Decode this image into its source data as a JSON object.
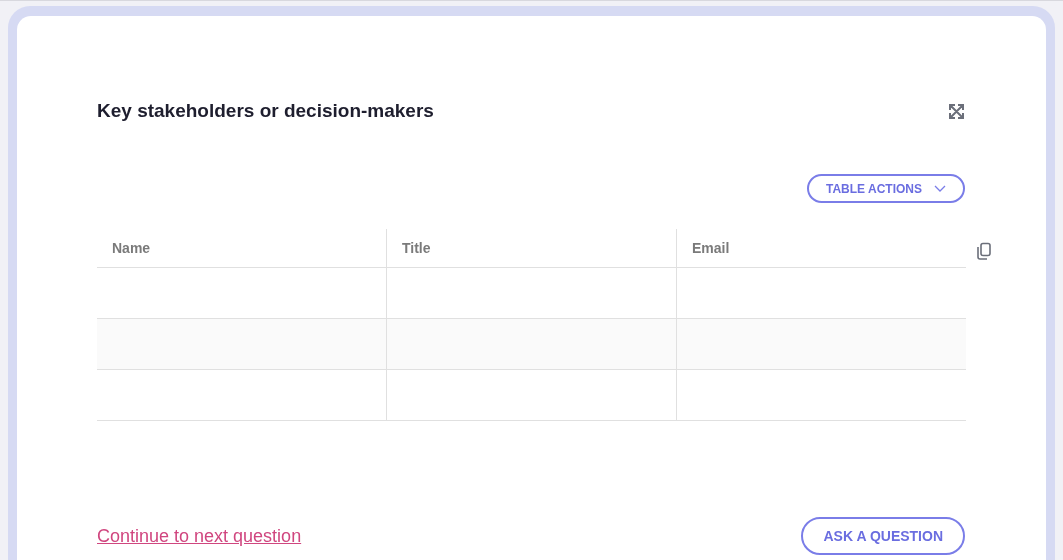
{
  "card": {
    "title": "Key stakeholders or decision-makers"
  },
  "table_actions": {
    "label": "TABLE ACTIONS"
  },
  "table": {
    "columns": [
      "Name",
      "Title",
      "Email"
    ]
  },
  "footer": {
    "link": "Continue to next question",
    "button": "ASK A QUESTION"
  }
}
